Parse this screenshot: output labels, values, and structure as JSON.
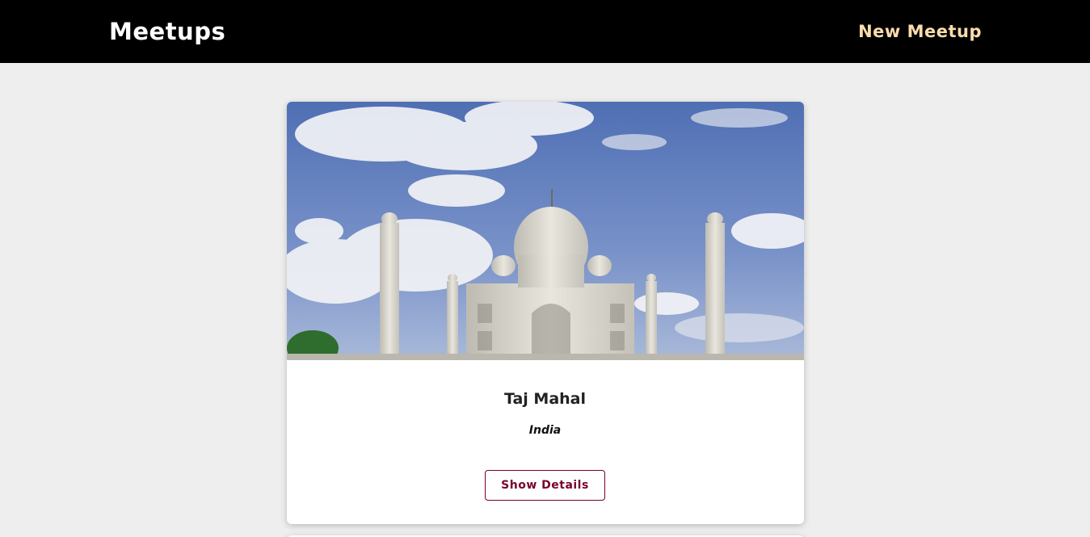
{
  "header": {
    "logo": "Meetups",
    "nav_new_meetup": "New Meetup"
  },
  "meetups": [
    {
      "title": "Taj Mahal",
      "address": "India",
      "button_label": "Show Details",
      "image_subject": "taj-mahal-photo"
    }
  ],
  "colors": {
    "header_bg": "#000000",
    "nav_link": "#fcdcac",
    "page_bg": "#eeeeee",
    "button_accent": "#77002e"
  }
}
